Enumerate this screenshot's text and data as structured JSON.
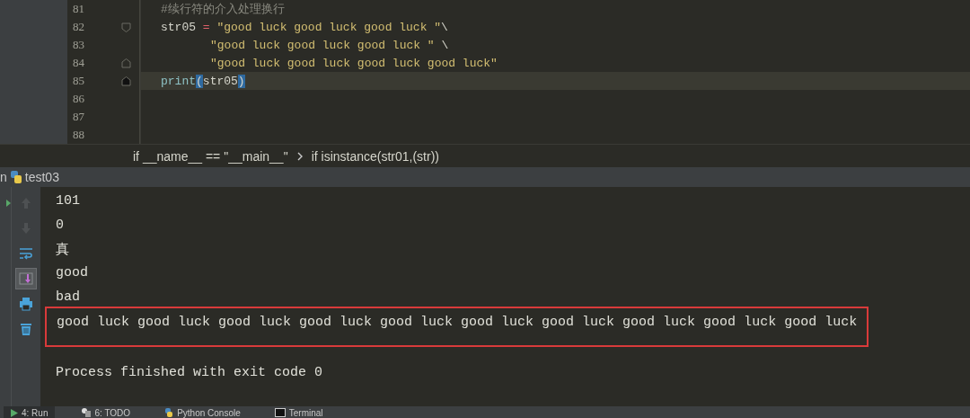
{
  "editor": {
    "lines": [
      {
        "number": "81",
        "kind": "plain",
        "current": false,
        "continuation": false,
        "tokens": [
          {
            "kind": "comment",
            "text": "#续行符的介入处理换行"
          }
        ]
      },
      {
        "number": "82",
        "kind": "fold-start",
        "current": false,
        "continuation": false,
        "tokens": [
          {
            "kind": "name",
            "text": "str05 "
          },
          {
            "kind": "operator",
            "text": "="
          },
          {
            "kind": "string",
            "text": " \"good luck good luck good luck \""
          },
          {
            "kind": "name",
            "text": "\\"
          }
        ]
      },
      {
        "number": "83",
        "kind": "plain",
        "current": false,
        "continuation": true,
        "tokens": [
          {
            "kind": "string",
            "text": "\"good luck good luck good luck \""
          },
          {
            "kind": "name",
            "text": " \\"
          }
        ]
      },
      {
        "number": "84",
        "kind": "fold-end",
        "current": false,
        "continuation": true,
        "tokens": [
          {
            "kind": "string",
            "text": "\"good luck good luck good luck good luck\""
          }
        ]
      },
      {
        "number": "85",
        "kind": "caret-end",
        "current": true,
        "continuation": false,
        "tokens": [
          {
            "kind": "builtin",
            "text": "print"
          },
          {
            "kind": "bracket",
            "text": "("
          },
          {
            "kind": "name",
            "text": "str05"
          },
          {
            "kind": "bracket",
            "text": ")"
          }
        ]
      },
      {
        "number": "86",
        "kind": "plain"
      },
      {
        "number": "87",
        "kind": "plain"
      },
      {
        "number": "88",
        "kind": "plain"
      }
    ]
  },
  "breadcrumb": [
    "if __name__ == \"__main__\"",
    "if isinstance(str01,(str))"
  ],
  "run_panel": {
    "title_cut": "n",
    "config": "test03",
    "toolbar": [
      {
        "kind": "up",
        "disabled": true,
        "on": false
      },
      {
        "kind": "down",
        "disabled": true,
        "on": false
      },
      {
        "kind": "wrap",
        "disabled": false,
        "on": false
      },
      {
        "kind": "scroll-end",
        "disabled": false,
        "on": true
      },
      {
        "kind": "print",
        "disabled": false,
        "on": false
      },
      {
        "kind": "trash",
        "disabled": false,
        "on": false
      }
    ],
    "output": [
      {
        "text": "101",
        "highlighted": false
      },
      {
        "text": "0",
        "highlighted": false
      },
      {
        "text": "真",
        "highlighted": false
      },
      {
        "text": "good",
        "highlighted": false
      },
      {
        "text": "bad",
        "highlighted": false
      },
      {
        "text": "good luck good luck good luck good luck good luck good luck good luck good luck good luck good luck",
        "highlighted": true
      },
      {
        "text": "Process finished with exit code 0",
        "highlighted": false
      }
    ]
  },
  "bottom_tabs": [
    {
      "label": "4: Run",
      "kind": "run",
      "selected": true
    },
    {
      "label": "6: TODO",
      "kind": "todo",
      "selected": false
    },
    {
      "label": "Python Console",
      "kind": "python",
      "selected": false
    },
    {
      "label": "Terminal",
      "kind": "terminal",
      "selected": false
    }
  ]
}
